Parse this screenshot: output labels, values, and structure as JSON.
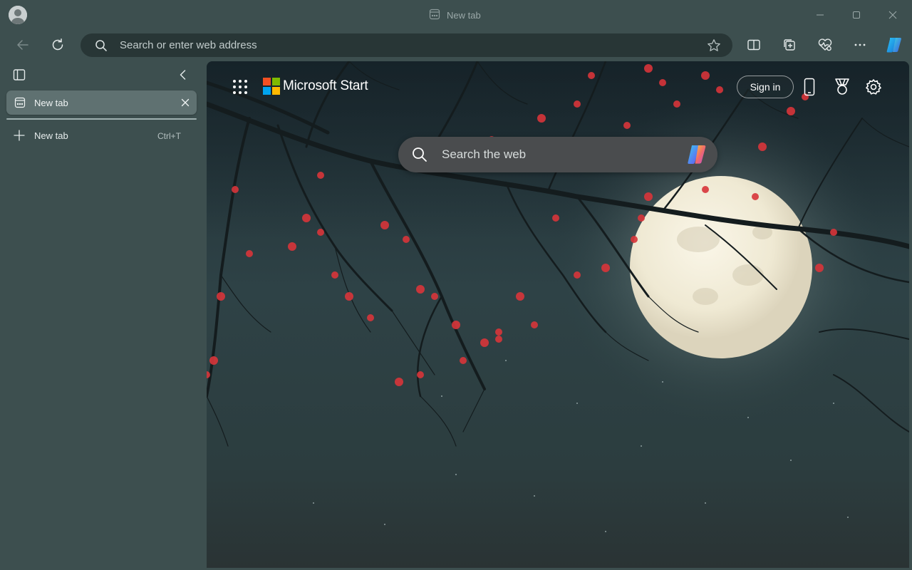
{
  "window": {
    "title": "New tab"
  },
  "toolbar": {
    "address_placeholder": "Search or enter web address"
  },
  "sidebar": {
    "tabs": [
      {
        "label": "New tab"
      }
    ],
    "new_tab": {
      "label": "New tab",
      "shortcut": "Ctrl+T"
    }
  },
  "newtab_page": {
    "brand": "Microsoft Start",
    "signin_label": "Sign in",
    "search_placeholder": "Search the web"
  },
  "colors": {
    "frame": "#3d4f4f",
    "address_bar": "#283636",
    "active_tab": "#5f7171",
    "blossom": "#d8353a",
    "moon": "#f1ecd8"
  },
  "icons": {
    "avatar": "profile-avatar-icon",
    "back": "arrow-left-icon",
    "refresh": "refresh-icon",
    "favorite": "star-icon",
    "split": "split-screen-icon",
    "collections": "collections-icon",
    "performance": "heart-pulse-icon",
    "more": "more-dots-icon",
    "copilot": "copilot-icon"
  }
}
